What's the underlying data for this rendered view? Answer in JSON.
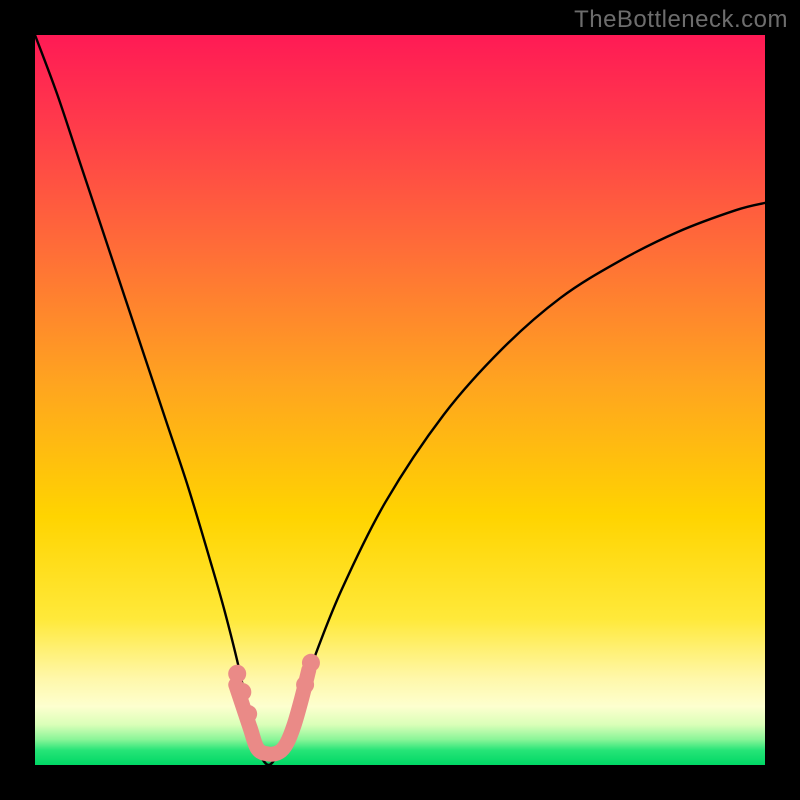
{
  "watermark": "TheBottleneck.com",
  "chart_data": {
    "type": "line",
    "title": "",
    "xlabel": "",
    "ylabel": "",
    "xlim": [
      0,
      100
    ],
    "ylim": [
      0,
      100
    ],
    "background_gradient": {
      "top_color": "#ff1f54",
      "mid_color": "#ffe400",
      "bottom_band_color": "#00e06a"
    },
    "curve": {
      "description": "Single V-shaped bottleneck curve; high at left, dips to near-zero around x≈32, rises again toward right.",
      "x": [
        0,
        3,
        6,
        9,
        12,
        15,
        18,
        21,
        24,
        26,
        28,
        29,
        30,
        31,
        32,
        33,
        34,
        36,
        38,
        42,
        48,
        56,
        64,
        72,
        80,
        88,
        96,
        100
      ],
      "y": [
        100,
        92,
        83,
        74,
        65,
        56,
        47,
        38,
        28,
        21,
        13,
        8,
        3,
        1,
        0,
        1,
        3,
        8,
        14,
        24,
        36,
        48,
        57,
        64,
        69,
        73,
        76,
        77
      ]
    },
    "marker_band": {
      "description": "Short salmon U-shaped marker segment at the curve trough",
      "color": "#ea8a87",
      "x": [
        27.5,
        28.5,
        29.5,
        30.5,
        32.0,
        33.5,
        34.5,
        35.5,
        36.5,
        37.5
      ],
      "y": [
        11,
        8,
        5,
        2.2,
        1.5,
        1.8,
        3,
        5.5,
        9,
        13
      ]
    },
    "marker_dots": {
      "color": "#ea8a87",
      "points": [
        {
          "x": 27.7,
          "y": 12.5
        },
        {
          "x": 28.4,
          "y": 10.0
        },
        {
          "x": 29.2,
          "y": 7.0
        },
        {
          "x": 37.0,
          "y": 11.0
        },
        {
          "x": 37.8,
          "y": 14.0
        }
      ]
    }
  }
}
